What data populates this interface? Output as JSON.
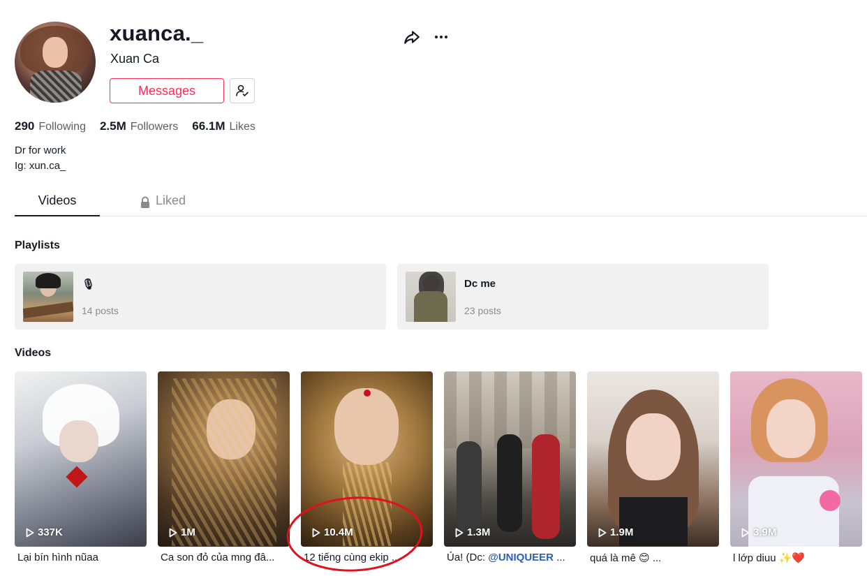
{
  "profile": {
    "username": "xuanca._",
    "nickname": "Xuan Ca",
    "messages_label": "Messages",
    "stats": [
      {
        "value": "290",
        "label": "Following"
      },
      {
        "value": "2.5M",
        "label": "Followers"
      },
      {
        "value": "66.1M",
        "label": "Likes"
      }
    ],
    "bio": [
      "Dr for work",
      "Ig: xun.ca_"
    ]
  },
  "tabs": {
    "videos": "Videos",
    "liked": "Liked"
  },
  "playlists": {
    "title": "Playlists",
    "items": [
      {
        "name": "🎙",
        "count": "14 posts"
      },
      {
        "name": "Dc me ",
        "count": "23 posts"
      }
    ]
  },
  "videos": {
    "title": "Videos",
    "items": [
      {
        "views": "337K",
        "caption": "Lại bín hình nũaa"
      },
      {
        "views": "1M",
        "caption": "Ca son đỏ của mng đâ..."
      },
      {
        "views": "10.4M",
        "caption": "12 tiếng cùng ekip ..."
      },
      {
        "views": "1.3M",
        "caption_prefix": "Ủa! (Dc: ",
        "mention": "@UNIQUEER",
        "caption_suffix": " ..."
      },
      {
        "views": "1.9M",
        "caption": "quá là mê 😊 ..."
      },
      {
        "views": "3.9M",
        "caption": "l lớp diuu ✨❤️"
      }
    ]
  },
  "colors": {
    "accent": "#fe2c55",
    "text": "#161823",
    "muted": "#8a8b91",
    "mention": "#2b5db9",
    "annotation": "#e0101e"
  },
  "icons": [
    "share-icon",
    "more-icon",
    "follow-user-icon",
    "lock-icon",
    "play-icon"
  ]
}
